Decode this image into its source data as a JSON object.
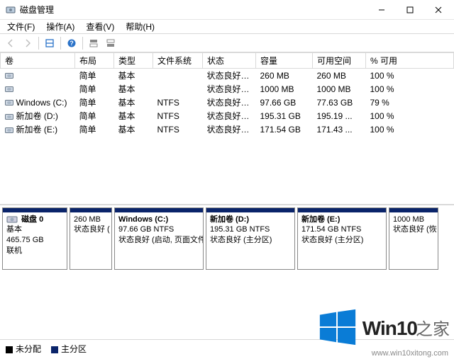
{
  "window": {
    "title": "磁盘管理"
  },
  "menu": {
    "file": "文件(F)",
    "action": "操作(A)",
    "view": "查看(V)",
    "help": "帮助(H)"
  },
  "columns": {
    "volume": "卷",
    "layout": "布局",
    "type": "类型",
    "filesystem": "文件系统",
    "status": "状态",
    "capacity": "容量",
    "free": "可用空间",
    "pct": "% 可用"
  },
  "rows": [
    {
      "name": "",
      "layout": "简单",
      "type": "基本",
      "fs": "",
      "status": "状态良好 (...",
      "cap": "260 MB",
      "free": "260 MB",
      "pct": "100 %"
    },
    {
      "name": "",
      "layout": "简单",
      "type": "基本",
      "fs": "",
      "status": "状态良好 (...",
      "cap": "1000 MB",
      "free": "1000 MB",
      "pct": "100 %"
    },
    {
      "name": "Windows (C:)",
      "layout": "简单",
      "type": "基本",
      "fs": "NTFS",
      "status": "状态良好 (...",
      "cap": "97.66 GB",
      "free": "77.63 GB",
      "pct": "79 %"
    },
    {
      "name": "新加卷 (D:)",
      "layout": "简单",
      "type": "基本",
      "fs": "NTFS",
      "status": "状态良好 (...",
      "cap": "195.31 GB",
      "free": "195.19 ...",
      "pct": "100 %"
    },
    {
      "name": "新加卷 (E:)",
      "layout": "简单",
      "type": "基本",
      "fs": "NTFS",
      "status": "状态良好 (...",
      "cap": "171.54 GB",
      "free": "171.43 ...",
      "pct": "100 %"
    }
  ],
  "disk": {
    "label": "磁盘 0",
    "type": "基本",
    "size": "465.75 GB",
    "status": "联机"
  },
  "parts": [
    {
      "name": "",
      "size": "260 MB",
      "status": "状态良好 ("
    },
    {
      "name": "Windows  (C:)",
      "size": "97.66 GB NTFS",
      "status": "状态良好 (启动, 页面文件"
    },
    {
      "name": "新加卷  (D:)",
      "size": "195.31 GB NTFS",
      "status": "状态良好 (主分区)"
    },
    {
      "name": "新加卷  (E:)",
      "size": "171.54 GB NTFS",
      "status": "状态良好 (主分区)"
    },
    {
      "name": "",
      "size": "1000 MB",
      "status": "状态良好 (恢"
    }
  ],
  "legend": {
    "unalloc": "未分配",
    "primary": "主分区"
  },
  "watermark": {
    "brand": "Win10",
    "suffix": "之家",
    "url": "www.win10xitong.com"
  }
}
